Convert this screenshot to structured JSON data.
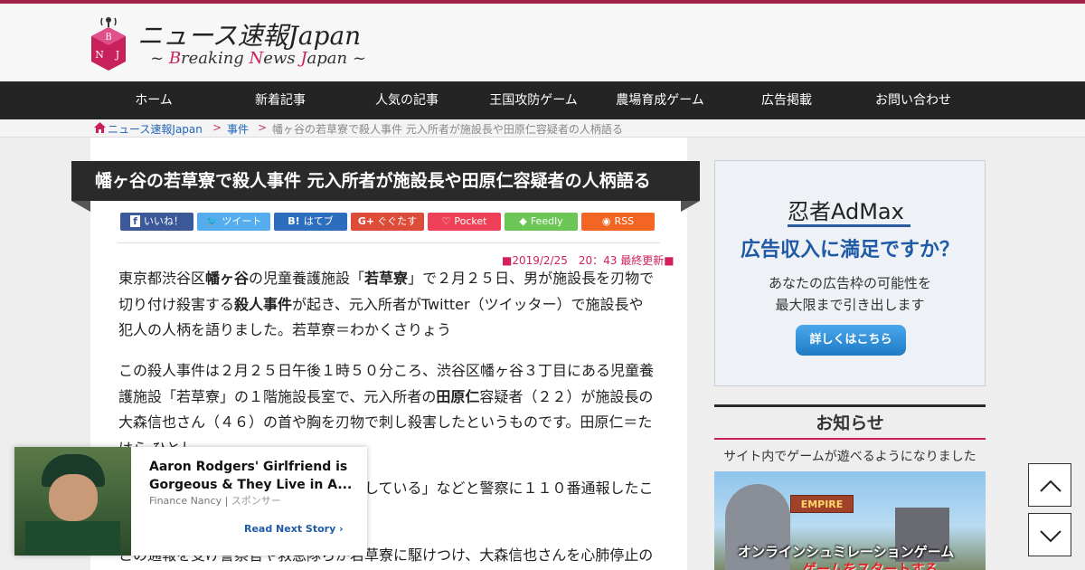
{
  "site": {
    "title": "ニュース速報Japan",
    "subtitle_parts": [
      "~ ",
      "B",
      "reaking ",
      "N",
      "ews ",
      "J",
      "apan ~"
    ],
    "logo_letters": [
      "B",
      "N",
      "J"
    ],
    "brand_color": "#c8205a"
  },
  "nav": [
    "ホーム",
    "新着記事",
    "人気の記事",
    "王国攻防ゲーム",
    "農場育成ゲーム",
    "広告掲載",
    "お問い合わせ"
  ],
  "breadcrumb": {
    "home": "ニュース速報Japan",
    "sep": ">",
    "category": "事件",
    "current": "幡ヶ谷の若草寮で殺人事件 元入所者が施設長や田原仁容疑者の人柄語る"
  },
  "article": {
    "title": "幡ヶ谷の若草寮で殺人事件 元入所者が施設長や田原仁容疑者の人柄語る",
    "date": "■2019/2/25　20：43 最終更新■",
    "share": [
      {
        "label": "いいね！",
        "icon": "f",
        "color": "#3b5998"
      },
      {
        "label": "ツイート",
        "icon": "bird",
        "color": "#55acee"
      },
      {
        "label": "はてブ",
        "icon": "B!",
        "color": "#2c6ebd"
      },
      {
        "label": "ぐぐたす",
        "icon": "G+",
        "color": "#dd4b39"
      },
      {
        "label": "Pocket",
        "icon": "pocket",
        "color": "#ee4056"
      },
      {
        "label": "Feedly",
        "icon": "feedly",
        "color": "#6cc655"
      },
      {
        "label": "RSS",
        "icon": "rss",
        "color": "#f26522"
      }
    ],
    "p1": [
      "東京都渋谷区",
      "幡ヶ谷",
      "の児童養護施設「",
      "若草寮",
      "」で２月２５日、男が施設長を刃物で切り付け殺害する",
      "殺人事件",
      "が起き、元入所者がTwitter（ツイッター）で施設長や犯人の人柄を語りました。若草寮＝わかくさりょう"
    ],
    "p2": [
      "この殺人事件は２月２５日午後１時５０分ころ、渋谷区幡ヶ谷３丁目にある児童養護施設「若草寮」の１階施設長室で、元入所者の",
      "田原仁",
      "容疑者（２２）が施設長の大森信也さん（４６）の首や胸を刃物で刺し殺害したというものです。田原仁＝たはら ひとし"
    ],
    "p3": "している」などと警察に１１０番通報したこ",
    "p4": "この通報を受け警察官や救急隊らが若草寮に駆けつけ、大森信也さんを心肺停止の"
  },
  "sidebar": {
    "ad_brand": "忍者AdMax",
    "ad_question": "広告収入に満足ですか？",
    "ad_line1": "あなたの広告枠の可能性を",
    "ad_line2": "最大限まで引き出します",
    "ad_button": "詳しくはこちら",
    "notice_title": "お知らせ",
    "notice_text": "サイト内でゲームが遊べるようになりました",
    "game_logo": "EMPIRE",
    "game_text": "オンラインシュミレーションゲーム",
    "game_cta": "ゲームをスタートする"
  },
  "popup": {
    "headline": "Aaron Rodgers' Girlfriend is Gorgeous & They Live in A...",
    "source": "Finance Nancy",
    "sponsor": "スポンサー",
    "read_next": "Read Next Story"
  }
}
